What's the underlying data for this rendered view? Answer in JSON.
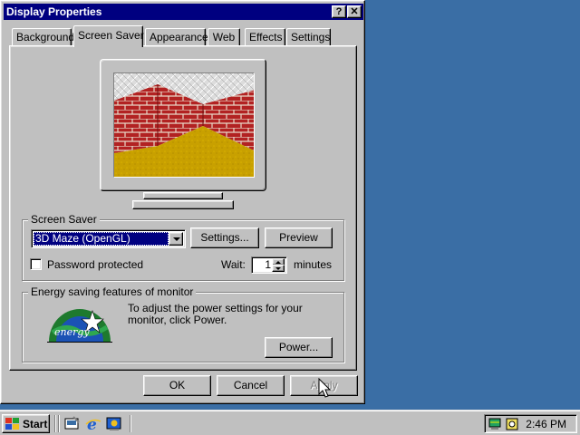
{
  "window": {
    "title": "Display Properties",
    "help_label": "?",
    "close_label": "✕"
  },
  "tabs": [
    {
      "label": "Background",
      "active": false
    },
    {
      "label": "Screen Saver",
      "active": true
    },
    {
      "label": "Appearance",
      "active": false
    },
    {
      "label": "Web",
      "active": false
    },
    {
      "label": "Effects",
      "active": false
    },
    {
      "label": "Settings",
      "active": false
    }
  ],
  "screen_saver": {
    "group_label": "Screen Saver",
    "selected": "3D Maze (OpenGL)",
    "settings_button": "Settings...",
    "preview_button": "Preview",
    "password_label": "Password protected",
    "password_checked": false,
    "wait_label": "Wait:",
    "wait_value": "1",
    "wait_unit": "minutes"
  },
  "energy": {
    "group_label": "Energy saving features of monitor",
    "description": "To adjust the power settings for your monitor, click Power.",
    "power_button": "Power...",
    "logo_text": "energy"
  },
  "footer": {
    "ok": "OK",
    "cancel": "Cancel",
    "apply": "Apply",
    "apply_enabled": false
  },
  "taskbar": {
    "start_label": "Start",
    "quick_launch": [
      "show-desktop-icon",
      "internet-explorer-icon",
      "channels-icon"
    ],
    "tray_icons": [
      "display-settings-icon",
      "scheduler-icon"
    ],
    "clock": "2:46 PM"
  },
  "colors": {
    "desktop": "#3a6ea5",
    "title_bar": "#000080",
    "face": "#c0c0c0",
    "brick": "#b22222",
    "floor": "#c8a000"
  }
}
